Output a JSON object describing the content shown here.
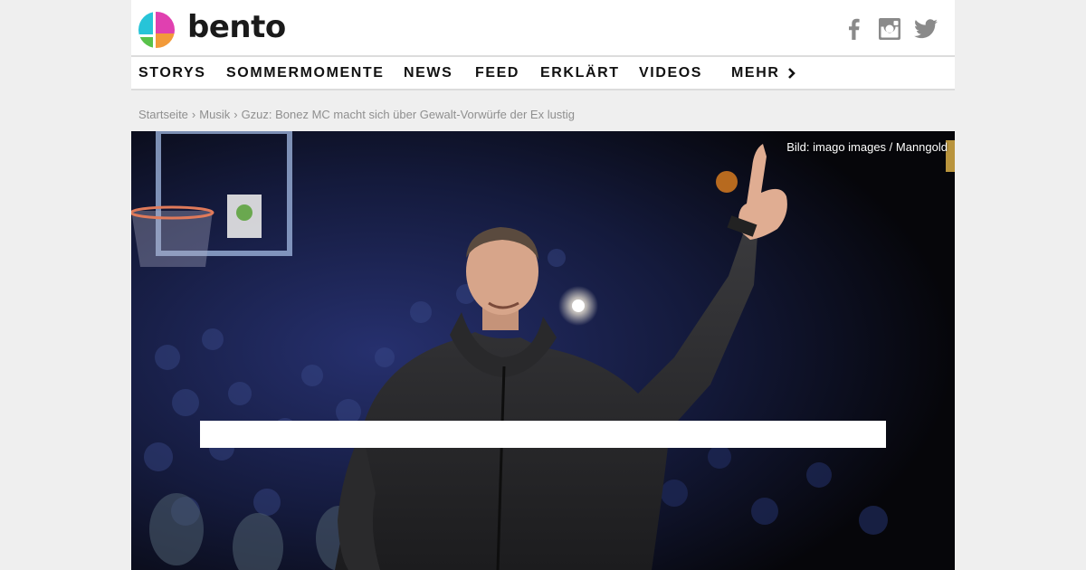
{
  "header": {
    "brand": "bento",
    "social": [
      {
        "name": "facebook",
        "icon": "facebook-icon"
      },
      {
        "name": "instagram",
        "icon": "instagram-icon"
      },
      {
        "name": "twitter",
        "icon": "twitter-icon"
      }
    ]
  },
  "nav": {
    "items": [
      "STORYS",
      "SOMMERMOMENTE",
      "NEWS",
      "FEED",
      "ERKLÄRT",
      "VIDEOS"
    ],
    "more_label": "MEHR"
  },
  "breadcrumb": {
    "home": "Startseite",
    "section": "Musik",
    "current": "Gzuz: Bonez MC macht sich über Gewalt-Vorwürfe der Ex lustig",
    "separator": "›"
  },
  "hero": {
    "credit": "Bild: imago images  / Manngold"
  },
  "colors": {
    "background": "#efefef",
    "logo_magenta": "#e040b0",
    "logo_cyan": "#27c4d8",
    "logo_green": "#59c24a",
    "logo_orange": "#f29a3a"
  }
}
